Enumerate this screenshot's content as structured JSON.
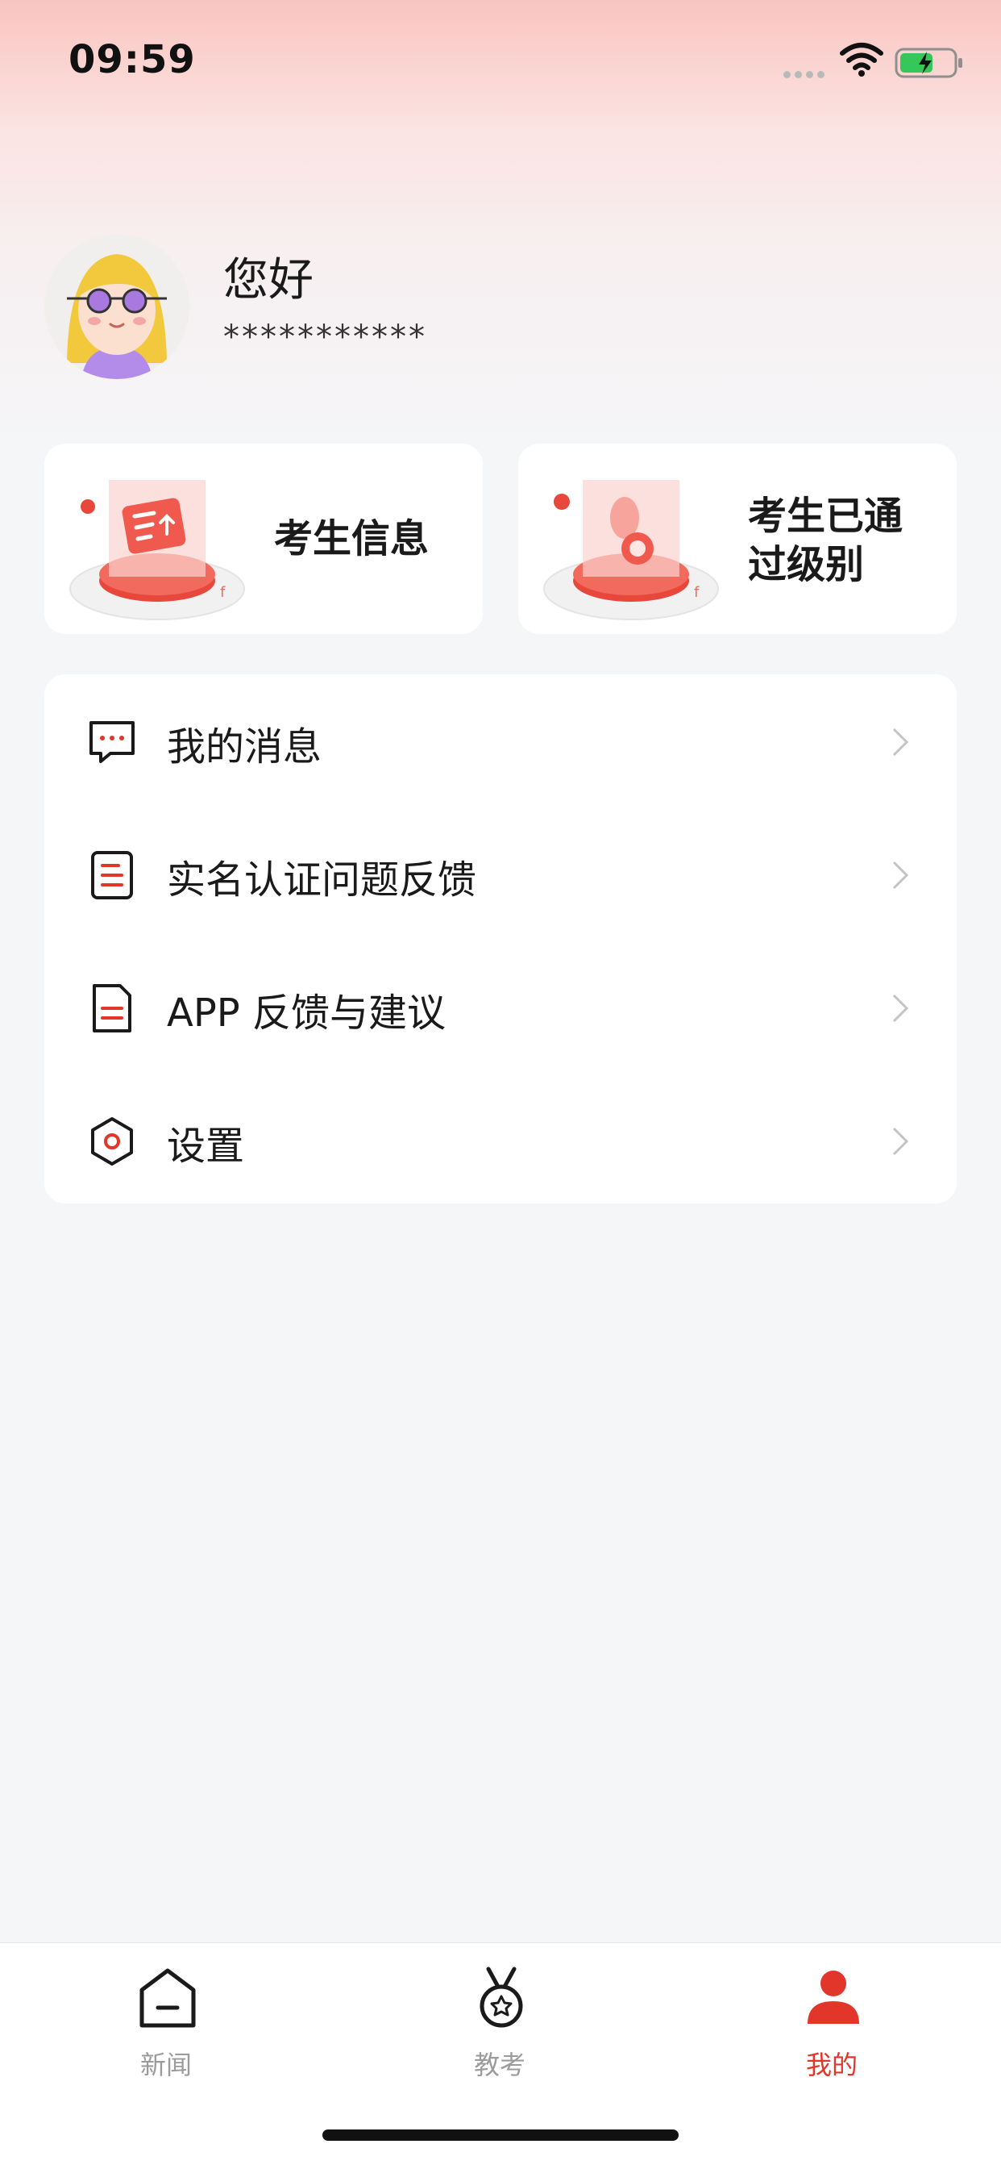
{
  "status_bar": {
    "time": "09:59"
  },
  "profile": {
    "greeting": "您好",
    "masked_id": "***********"
  },
  "cards": [
    {
      "label": "考生信息",
      "icon": "document-upload-illustration"
    },
    {
      "label": "考生已通过级别",
      "icon": "medal-illustration"
    }
  ],
  "menu": {
    "items": [
      {
        "label": "我的消息",
        "icon": "message-icon"
      },
      {
        "label": "实名认证问题反馈",
        "icon": "form-icon"
      },
      {
        "label": "APP 反馈与建议",
        "icon": "document-icon"
      },
      {
        "label": "设置",
        "icon": "settings-icon"
      }
    ]
  },
  "tab_bar": {
    "tabs": [
      {
        "label": "新闻",
        "icon": "home-icon",
        "active": false
      },
      {
        "label": "教考",
        "icon": "medal-icon",
        "active": false
      },
      {
        "label": "我的",
        "icon": "user-icon",
        "active": true
      }
    ]
  },
  "colors": {
    "accent": "#e3362b",
    "tab_inactive": "#9b9b9b",
    "background": "#f5f6f8",
    "header_gradient_top": "#f9c4c0"
  }
}
